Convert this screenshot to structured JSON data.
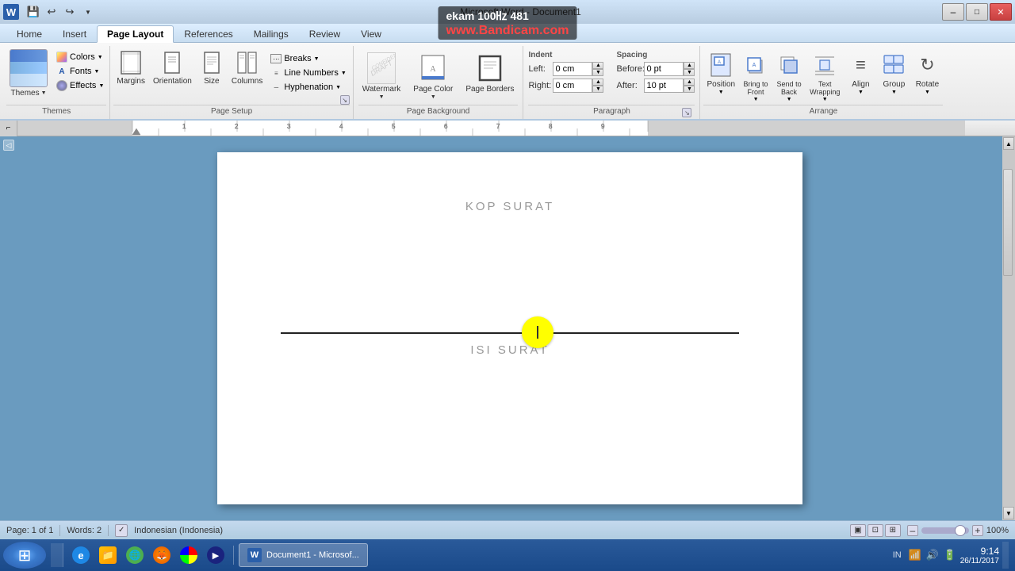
{
  "titlebar": {
    "title": "Microsoft Word - Document1",
    "logo": "W",
    "quickaccess": {
      "save": "💾",
      "undo": "↩",
      "redo": "↪",
      "dropdown": "▼"
    },
    "controls": {
      "minimize": "–",
      "maximize": "□",
      "close": "✕"
    }
  },
  "ribbon": {
    "tabs": [
      "Home",
      "Insert",
      "Page Layout",
      "References",
      "Mailings",
      "Review",
      "View"
    ],
    "active_tab": "Page Layout",
    "sections": {
      "themes": {
        "label": "Themes",
        "main_label": "Themes",
        "sub_items": [
          {
            "label": "Colors",
            "icon": "🎨"
          },
          {
            "label": "Fonts",
            "icon": "A"
          },
          {
            "label": "Effects",
            "icon": "✨"
          }
        ]
      },
      "page_setup": {
        "label": "Page Setup",
        "items": [
          {
            "label": "Margins",
            "icon": "▣"
          },
          {
            "label": "Orientation",
            "icon": "⬜"
          },
          {
            "label": "Size",
            "icon": "📄"
          },
          {
            "label": "Columns",
            "icon": "⊞"
          }
        ],
        "right_items": [
          {
            "label": "Breaks ▼",
            "icon": ""
          },
          {
            "label": "Line Numbers ▼",
            "icon": ""
          },
          {
            "label": "Hyphenation ▼",
            "icon": ""
          }
        ]
      },
      "page_background": {
        "label": "Page Background",
        "items": [
          {
            "label": "Watermark",
            "icon": ""
          },
          {
            "label": "Page Color",
            "icon": ""
          },
          {
            "label": "Page Borders",
            "icon": ""
          }
        ]
      },
      "paragraph": {
        "label": "Paragraph",
        "indent_label": "Indent",
        "spacing_label": "Spacing",
        "indent": {
          "left_label": "Left:",
          "left_value": "0 cm",
          "right_label": "Right:",
          "right_value": "0 cm"
        },
        "spacing": {
          "before_label": "Before:",
          "before_value": "0 pt",
          "after_label": "After:",
          "after_value": "10 pt"
        }
      },
      "arrange": {
        "label": "Arrange",
        "items": [
          {
            "label": "Position",
            "icon": "⊡"
          },
          {
            "label": "Bring to Front",
            "icon": "↑"
          },
          {
            "label": "Send to Back",
            "icon": "↓"
          },
          {
            "label": "Text Wrapping",
            "icon": "⌸"
          },
          {
            "label": "Align",
            "icon": "≡"
          },
          {
            "label": "Group",
            "icon": "⊞"
          },
          {
            "label": "Rotate",
            "icon": "↻"
          }
        ]
      }
    }
  },
  "document": {
    "kop_surat": "KOP SURAT",
    "isi_surat": "ISI SURAT"
  },
  "statusbar": {
    "page_info": "Page: 1 of 1",
    "words": "Words: 2",
    "language": "Indonesian (Indonesia)",
    "zoom": "100%"
  },
  "taskbar": {
    "start": "⊞",
    "buttons": [
      {
        "label": "",
        "icon": "🌐"
      },
      {
        "label": "",
        "icon": "📁"
      },
      {
        "label": "",
        "icon": "🌍"
      },
      {
        "label": "",
        "icon": "🦊"
      },
      {
        "label": "",
        "icon": "🔵"
      },
      {
        "label": "",
        "icon": "▶"
      },
      {
        "label": "Document1 - Microsof...",
        "icon": "W",
        "active": true
      }
    ],
    "systray": {
      "time": "9:14",
      "date": "26/11/2017",
      "lang": "IN"
    }
  }
}
